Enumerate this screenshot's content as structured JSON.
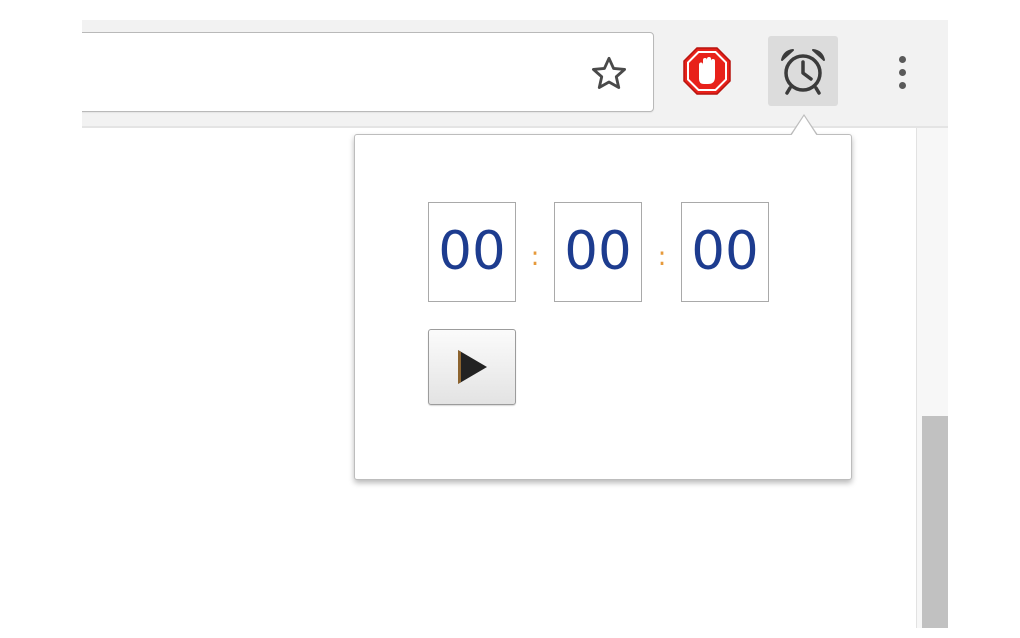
{
  "toolbar": {
    "bookmark_icon": "star-outline-icon",
    "extensions": [
      {
        "name": "adblock-extension",
        "icon": "stop-hand-icon",
        "color": "#e8211a"
      },
      {
        "name": "timer-extension",
        "icon": "alarm-clock-icon",
        "active": true
      }
    ],
    "menu_icon": "vertical-ellipsis-icon"
  },
  "timer_popup": {
    "hours": "00",
    "minutes": "00",
    "seconds": "00",
    "separator": ":",
    "separator_color": "#e69a3b",
    "digit_color": "#1d3c8f",
    "start_button_icon": "play-icon"
  }
}
